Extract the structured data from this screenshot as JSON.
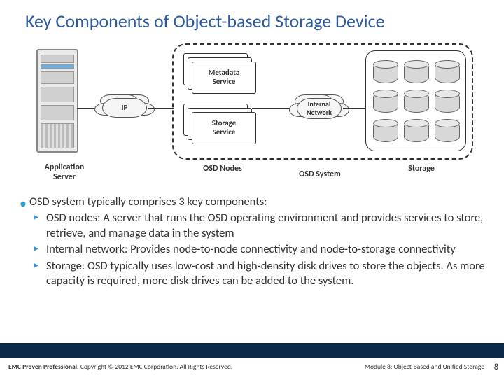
{
  "title": "Key Components of Object-based Storage Device",
  "diagram": {
    "app_server": "Application\nServer",
    "ip": "IP",
    "metadata": "Metadata\nService",
    "storage_svc": "Storage\nService",
    "osd_nodes": "OSD Nodes",
    "internal_net": "Internal\nNetwork",
    "osd_system": "OSD System",
    "storage": "Storage"
  },
  "bullets": {
    "lead": "OSD system typically comprises 3 key components:",
    "items": [
      "OSD nodes: A server that runs the OSD operating environment and provides services to store, retrieve, and manage data in the system",
      "Internal network: Provides node-to-node connectivity and node-to-storage connectivity",
      "Storage: OSD typically uses low-cost and high-density disk drives to store the objects. As more capacity is required, more disk drives can be added to the system."
    ]
  },
  "footer": {
    "brand": "EMC Proven Professional.",
    "copyright": "Copyright © 2012 EMC Corporation. All Rights Reserved.",
    "module": "Module 8: Object-Based and Unified Storage",
    "page": "8"
  }
}
